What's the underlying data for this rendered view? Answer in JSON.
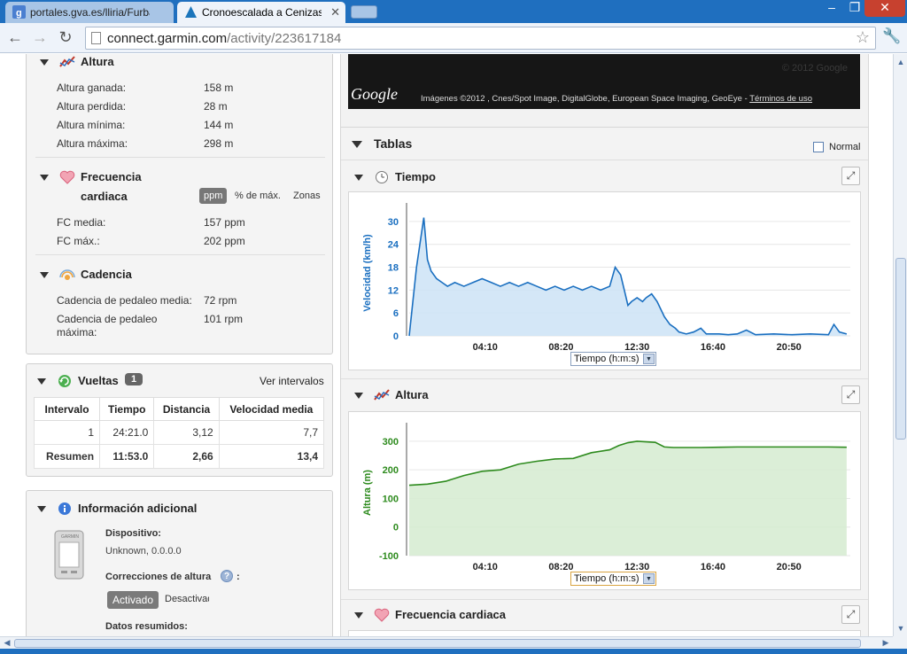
{
  "browser": {
    "tabs": [
      {
        "label": "portales.gva.es/lliria/Furbanis",
        "active": false
      },
      {
        "label": "Cronoescalada a Cenizas. Bus",
        "active": true
      }
    ],
    "url_host": "connect.garmin.com",
    "url_path": "/activity/223617184"
  },
  "altura": {
    "title": "Altura",
    "rows": [
      {
        "label": "Altura ganada:",
        "value": "158 m"
      },
      {
        "label": "Altura perdida:",
        "value": "28 m"
      },
      {
        "label": "Altura mínima:",
        "value": "144 m"
      },
      {
        "label": "Altura máxima:",
        "value": "298 m"
      }
    ]
  },
  "fc": {
    "title_line1": "Frecuencia",
    "title_line2": "cardiaca",
    "toggle": [
      "ppm",
      "% de máx.",
      "Zonas"
    ],
    "rows": [
      {
        "label": "FC media:",
        "value": "157 ppm"
      },
      {
        "label": "FC máx.:",
        "value": "202 ppm"
      }
    ]
  },
  "cadencia": {
    "title": "Cadencia",
    "rows": [
      {
        "label": "Cadencia de pedaleo media:",
        "value": "72 rpm"
      },
      {
        "label_line1": "Cadencia de pedaleo",
        "label_line2": "máxima:",
        "value": "101 rpm"
      }
    ]
  },
  "vueltas": {
    "title": "Vueltas",
    "count": "1",
    "link": "Ver intervalos",
    "headers": [
      "Intervalo",
      "Tiempo",
      "Distancia",
      "Velocidad media"
    ],
    "rows": [
      [
        "1",
        "24:21.0",
        "3,12",
        "7,7"
      ],
      [
        "Resumen",
        "11:53.0",
        "2,66",
        "13,4"
      ]
    ]
  },
  "info": {
    "title": "Información adicional",
    "device_label": "Dispositivo:",
    "device_value": "Unknown, 0.0.0.0",
    "corr_label": "Correcciones de altura",
    "corr_suffix": ":",
    "btn_on": "Activado",
    "btn_off": "Desactivado",
    "summary_label": "Datos resumidos:",
    "device_brand": "GARMIN"
  },
  "map": {
    "logo": "Google",
    "attribution": "Imágenes ©2012 , Cnes/Spot Image, DigitalGlobe, European Space Imaging, GeoEye -",
    "terms": "Términos de uso",
    "watermark": "© 2012 Google"
  },
  "tablas": {
    "title": "Tablas",
    "normal_label": "Normal"
  },
  "charts": [
    {
      "section_title": "Tiempo",
      "select_label": "Tiempo (h:m:s)",
      "color": "#1a6fc0",
      "fill": "#cde3f6",
      "chart_data": {
        "type": "area",
        "ylabel": "Velocidad (km/h)",
        "yticks": [
          0,
          6,
          12,
          18,
          24,
          30
        ],
        "ylim": [
          0,
          33
        ],
        "xticks": [
          "04:10",
          "08:20",
          "12:30",
          "16:40",
          "20:50"
        ],
        "x_minutes": [
          0,
          0.4,
          0.8,
          1.0,
          1.2,
          1.5,
          1.8,
          2.1,
          2.5,
          3.0,
          3.5,
          4.0,
          4.5,
          5.0,
          5.5,
          6.0,
          6.5,
          7.0,
          7.5,
          8.0,
          8.5,
          9.0,
          9.5,
          10.0,
          10.5,
          11.0,
          11.3,
          11.6,
          11.8,
          12.0,
          12.2,
          12.5,
          12.8,
          13.0,
          13.3,
          13.6,
          14.0,
          14.3,
          14.6,
          14.8,
          15.2,
          15.6,
          16.0,
          16.3,
          16.6,
          17.0,
          17.5,
          18.0,
          18.5,
          19.0,
          20.0,
          21.0,
          22.0,
          23.0,
          23.3,
          23.6,
          24.0
        ],
        "series": [
          {
            "values": [
              0,
              18,
              31,
              20,
              17,
              15,
              14,
              13,
              14,
              13,
              14,
              15,
              14,
              13,
              14,
              13,
              14,
              13,
              12,
              13,
              12,
              13,
              12,
              13,
              12,
              13,
              18,
              16,
              12,
              8,
              9,
              10,
              9,
              10,
              11,
              9,
              5,
              3,
              2,
              1,
              0.5,
              1,
              2,
              0.5,
              0.5,
              0.5,
              0.3,
              0.5,
              1.5,
              0.3,
              0.5,
              0.3,
              0.5,
              0.3,
              3,
              1,
              0.5
            ]
          }
        ]
      }
    },
    {
      "section_title": "Altura",
      "select_label": "Tiempo (h:m:s)",
      "color": "#2e8b1e",
      "fill": "#d5ebd0",
      "chart_data": {
        "type": "area",
        "ylabel": "Altura (m)",
        "yticks": [
          -100,
          0,
          100,
          200,
          300
        ],
        "ylim": [
          -100,
          340
        ],
        "xticks": [
          "04:10",
          "08:20",
          "12:30",
          "16:40",
          "20:50"
        ],
        "x_minutes": [
          0,
          1,
          2,
          3,
          4,
          5,
          6,
          7,
          8,
          9,
          10,
          11,
          11.5,
          12,
          12.5,
          13,
          13.5,
          14,
          14.5,
          15,
          16,
          17,
          18,
          19,
          20,
          21,
          22,
          23,
          24
        ],
        "series": [
          {
            "values": [
              146,
              150,
              160,
              180,
              195,
              200,
              220,
              230,
              238,
              240,
              260,
              270,
              285,
              295,
              300,
              298,
              296,
              280,
              278,
              278,
              278,
              279,
              280,
              280,
              280,
              280,
              280,
              280,
              279
            ]
          }
        ]
      }
    }
  ],
  "fc_section": {
    "title": "Frecuencia cardiaca"
  }
}
